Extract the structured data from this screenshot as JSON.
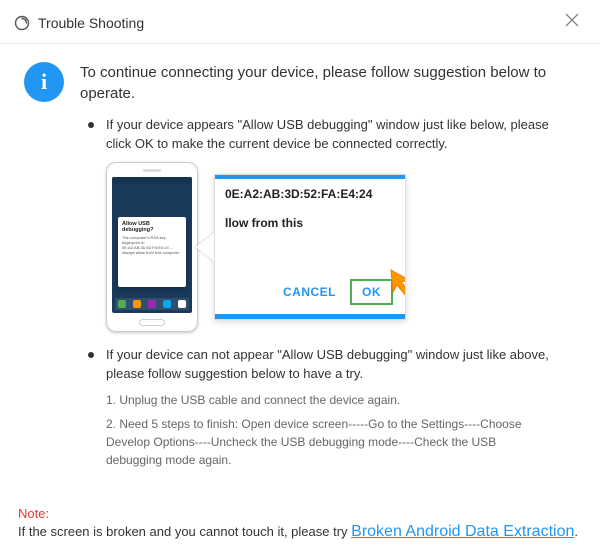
{
  "titlebar": {
    "title": "Trouble Shooting"
  },
  "intro": "To continue connecting your device, please follow suggestion below to operate.",
  "bullet1": "If your device appears \"Allow USB debugging\" window just like below, please click OK to make the current device  be connected correctly.",
  "bullet2": "If your device can not appear \"Allow USB debugging\" window just like above, please follow suggestion below to have a try.",
  "phone": {
    "dialog_title": "Allow USB debugging?",
    "dialog_body": "The computer's RSA key fingerprint is: 0E:A2:AB:3D:52:FA:E4:24 ... Always allow from this computer"
  },
  "zoom": {
    "rsa": "0E:A2:AB:3D:52:FA:E4:24",
    "allow_line": "llow from this",
    "cancel": "CANCEL",
    "ok": "OK"
  },
  "steps": {
    "s1": "1. Unplug the USB cable and connect the device again.",
    "s2": "2. Need 5 steps to finish: Open device screen-----Go to the Settings----Choose Develop Options----Uncheck the USB debugging mode----Check the USB debugging mode again."
  },
  "note": {
    "label": "Note:",
    "text": "If the screen is broken and you cannot touch it, please try ",
    "link": "Broken Android Data Extraction",
    "suffix": "."
  }
}
